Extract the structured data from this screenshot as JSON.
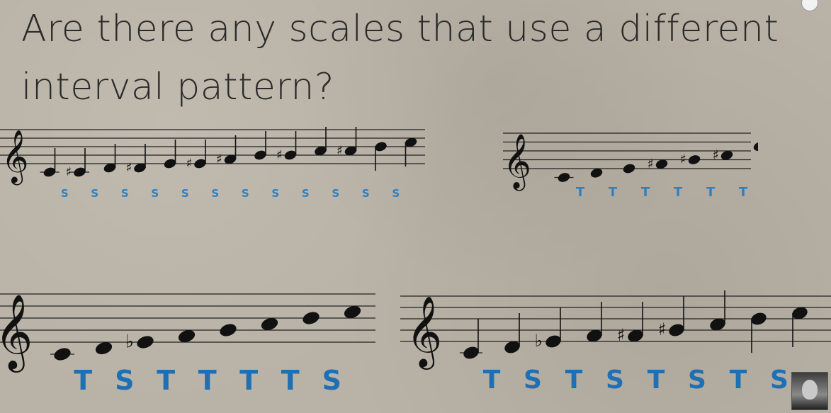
{
  "slide": {
    "title_line1": "Are there any scales that use a different",
    "title_line2": "interval pattern?"
  },
  "staves": [
    {
      "id": "chromatic",
      "intervals": [
        "S",
        "S",
        "S",
        "S",
        "S",
        "S",
        "S",
        "S",
        "S",
        "S",
        "S",
        "S"
      ],
      "notes": [
        "C",
        "C#",
        "D",
        "D#",
        "E",
        "E#",
        "F#",
        "G",
        "G#",
        "A",
        "A#",
        "B",
        "C"
      ],
      "interval_color": "#2f7fc1"
    },
    {
      "id": "whole-tone",
      "intervals": [
        "T",
        "T",
        "T",
        "T",
        "T",
        "T"
      ],
      "notes": [
        "C",
        "D",
        "E",
        "F#",
        "G#",
        "A#",
        "C"
      ],
      "interval_color": "#2f7fc1"
    },
    {
      "id": "melodic-minor-like",
      "intervals": [
        "T",
        "S",
        "T",
        "T",
        "T",
        "T",
        "S"
      ],
      "notes": [
        "C",
        "D",
        "Eb",
        "F",
        "G",
        "A",
        "B",
        "C"
      ],
      "interval_color": "#1f6fb5"
    },
    {
      "id": "octatonic",
      "intervals": [
        "T",
        "S",
        "T",
        "S",
        "T",
        "S",
        "T",
        "S"
      ],
      "notes": [
        "C",
        "D",
        "Eb",
        "F",
        "F#",
        "G#",
        "A",
        "B",
        "C"
      ],
      "interval_color": "#1f6fb5"
    }
  ],
  "colors": {
    "background": "#b9b2a6",
    "ink": "#111111",
    "staff_line": "#222222",
    "title": "#2a2a2a"
  },
  "icons": {
    "clef": "treble-clef-icon",
    "presenter": "presenter-thumbnail"
  }
}
